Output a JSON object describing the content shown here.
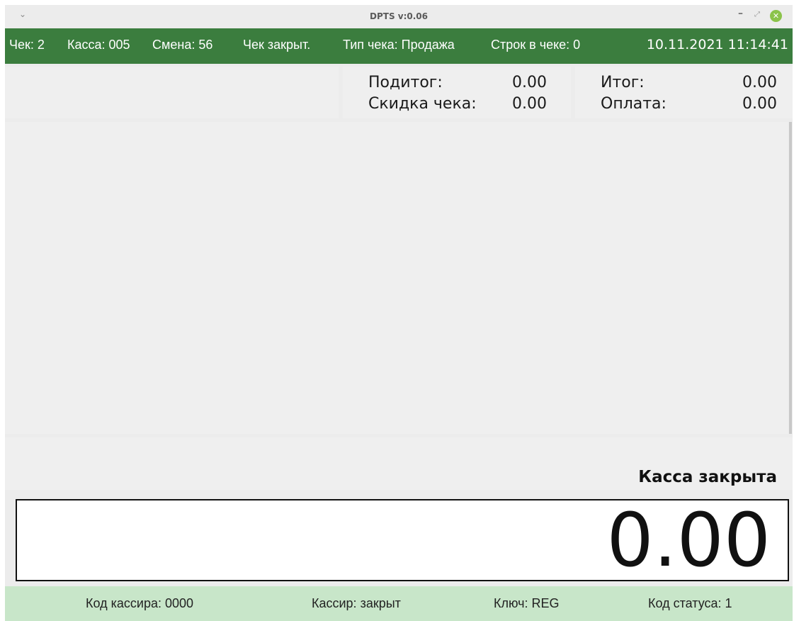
{
  "window": {
    "title": "DPTS v:0.06",
    "menu_glyph": "⌄",
    "minimize_glyph": "–",
    "maximize_glyph": "⤢",
    "close_glyph": "✕",
    "close_color": "#8bc34a"
  },
  "status": {
    "receipt": "Чек: 2",
    "register": "Касса: 005",
    "shift": "Смена:  56",
    "receipt_state": "Чек  закрыт.",
    "receipt_type": "Тип чека: Продажа",
    "lines": "Строк в чеке:  0",
    "datetime": "10.11.2021 11:14:41",
    "bar_color": "#3b7d3e"
  },
  "totals": {
    "subtotal_label": "Подитог:",
    "subtotal_value": "0.00",
    "discount_label": "Скидка чека:",
    "discount_value": "0.00",
    "total_label": "Итог:",
    "total_value": "0.00",
    "payment_label": "Оплата:",
    "payment_value": "0.00"
  },
  "message": "Касса закрыта",
  "display_value": "0.00",
  "footer": {
    "cashier_code": "Код кассира: 0000",
    "cashier": "Кассир: закрыт",
    "key": "Ключ: REG",
    "status_code": "Код статуса: 1",
    "bar_color": "#c8e6c9"
  }
}
